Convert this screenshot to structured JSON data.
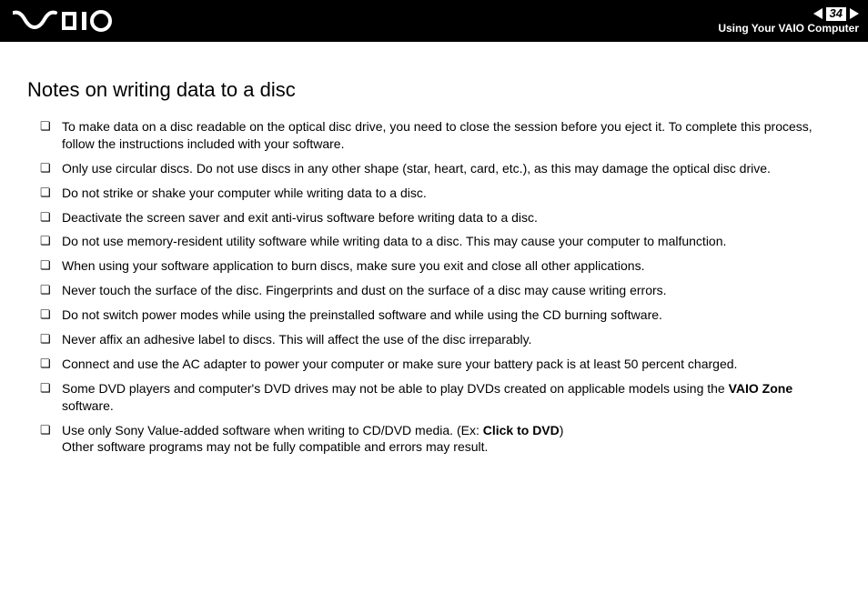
{
  "header": {
    "page_number": "34",
    "section": "Using Your VAIO Computer"
  },
  "content": {
    "title": "Notes on writing data to a disc",
    "items": [
      {
        "text": "To make data on a disc readable on the optical disc drive, you need to close the session before you eject it. To complete this process, follow the instructions included with your software."
      },
      {
        "text": "Only use circular discs. Do not use discs in any other shape (star, heart, card, etc.), as this may damage the optical disc drive."
      },
      {
        "text": "Do not strike or shake your computer while writing data to a disc."
      },
      {
        "text": "Deactivate the screen saver and exit anti-virus software before writing data to a disc."
      },
      {
        "text": "Do not use memory-resident utility software while writing data to a disc. This may cause your computer to malfunction."
      },
      {
        "text": "When using your software application to burn discs, make sure you exit and close all other applications."
      },
      {
        "text": "Never touch the surface of the disc. Fingerprints and dust on the surface of a disc may cause writing errors."
      },
      {
        "text": "Do not switch power modes while using the preinstalled software and while using the CD burning software."
      },
      {
        "text": "Never affix an adhesive label to discs. This will affect the use of the disc irreparably."
      },
      {
        "text": "Connect and use the AC adapter to power your computer or make sure your battery pack is at least 50 percent charged."
      },
      {
        "pre": "Some DVD players and computer's DVD drives may not be able to play DVDs created on applicable models using the ",
        "bold": "VAIO Zone",
        "post": " software."
      },
      {
        "pre": "Use only Sony Value-added software when writing to CD/DVD media. (Ex: ",
        "bold": "Click to DVD",
        "post": ")",
        "extra": "Other software programs may not be fully compatible and errors may result."
      }
    ]
  }
}
